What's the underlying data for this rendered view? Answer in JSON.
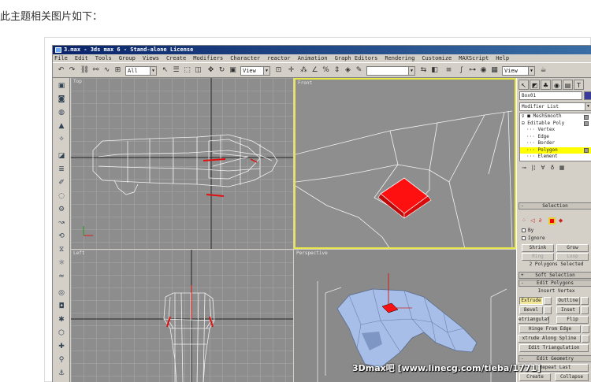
{
  "caption": "此主题相关图片如下：",
  "window": {
    "title": "3.max - 3ds max 6 - Stand-alone License"
  },
  "menu": [
    "File",
    "Edit",
    "Tools",
    "Group",
    "Views",
    "Create",
    "Modifiers",
    "Character",
    "reactor",
    "Animation",
    "Graph Editors",
    "Rendering",
    "Customize",
    "MAXScript",
    "Help"
  ],
  "toolbar": {
    "filter_value": "All",
    "refcoord_value": "View",
    "named_sel_value": "",
    "render_view_value": "View"
  },
  "viewports": {
    "top": "Top",
    "front": "Front",
    "left": "Left",
    "perspective": "Perspective"
  },
  "command_panel": {
    "object_name": "Box01",
    "modifier_list_label": "Modifier List",
    "stack": [
      {
        "label": "MeshSmooth",
        "selected": false
      },
      {
        "label": "Editable Poly",
        "selected": false
      },
      {
        "label": "Vertex",
        "selected": false
      },
      {
        "label": "Edge",
        "selected": false
      },
      {
        "label": "Border",
        "selected": false
      },
      {
        "label": "Polygon",
        "selected": true
      },
      {
        "label": "Element",
        "selected": false
      }
    ],
    "selection": {
      "title": "Selection",
      "by_label": "By",
      "ignore_label": "Ignore",
      "shrink_label": "Shrink",
      "grow_label": "Grow",
      "ring_label": "Ring",
      "loop_label": "Loop",
      "status": "2 Polygons Selected"
    },
    "soft_selection_title": "Soft Selection",
    "edit_polygons": {
      "title": "Edit Polygons",
      "insert_vertex": "Insert Vertex",
      "extrude": "Extrude",
      "outline": "Outline",
      "bevel": "Bevel",
      "inset": "Inset",
      "retriangulate": "etriangulat",
      "flip": "Flip",
      "hinge_from_edge": "Hinge From Edge",
      "extrude_along_spline": "xtrude Along Spline",
      "edit_triangulation": "Edit Triangulation"
    },
    "edit_geometry": {
      "title": "Edit Geometry",
      "repeat_last": "Repeat Last",
      "create": "Create",
      "collapse": "Collapse"
    }
  },
  "watermark": "3Dmax吧 [www.linecg.com/tieba/1771]"
}
